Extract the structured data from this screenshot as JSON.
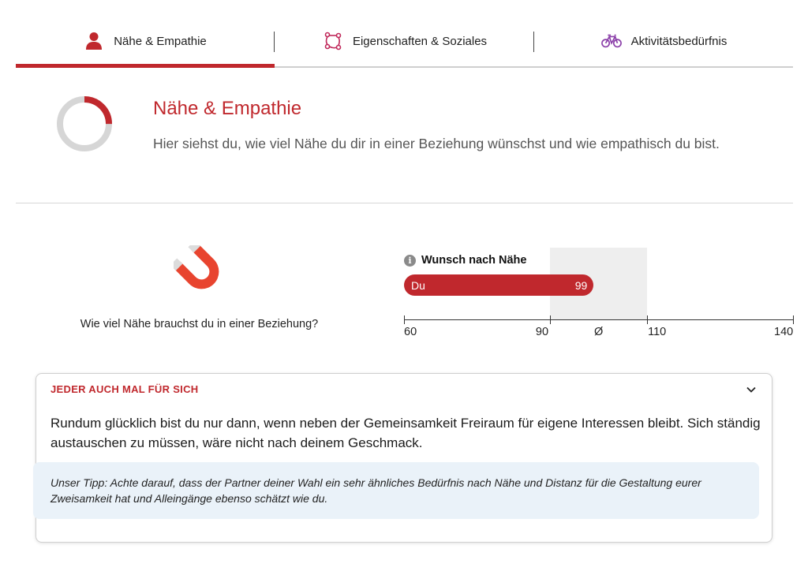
{
  "tabs": [
    {
      "label": "Nähe & Empathie",
      "icon": "person-icon",
      "active": true
    },
    {
      "label": "Eigenschaften & Soziales",
      "icon": "network-icon",
      "active": false
    },
    {
      "label": "Aktivitätsbedürfnis",
      "icon": "bicycle-icon",
      "active": false
    }
  ],
  "intro": {
    "title": "Nähe & Empathie",
    "description": "Hier siehst du, wie viel Nähe du dir in einer Beziehung wünschst und wie empathisch du bist."
  },
  "measure": {
    "question": "Wie viel Nähe brauchst du in einer Beziehung?",
    "bar_title": "Wunsch nach Nähe",
    "bar_label": "Du",
    "value": 99,
    "value_text": "99",
    "avg_symbol": "Ø",
    "axis": {
      "min": 60,
      "max": 140,
      "average_range": [
        90,
        110
      ]
    },
    "ticks": [
      {
        "value": 60,
        "label": "60"
      },
      {
        "value": 90,
        "label": "90"
      },
      {
        "value": 110,
        "label": "110"
      },
      {
        "value": 140,
        "label": "140"
      }
    ]
  },
  "card": {
    "header": "JEDER AUCH MAL FÜR SICH",
    "body": "Rundum glücklich bist du nur dann, wenn neben der Gemeinsamkeit Freiraum für eigene Interessen bleibt. Sich ständig austauschen zu müssen, wäre nicht nach deinem Geschmack.",
    "tip": "Unser Tipp: Achte darauf, dass der Partner deiner Wahl ein sehr ähnliches Bedürfnis nach Nähe und Distanz für die Gestaltung eurer Zweisamkeit hat und Alleingänge ebenso schätzt wie du.",
    "expanded": true
  },
  "ring_progress": 0.25,
  "colors": {
    "accent": "#c0282d",
    "network_icon": "#c0285a",
    "bicycle_icon": "#8a3ea8",
    "average_zone": "#eeeeee",
    "tip_bg": "#eaf2f9"
  }
}
